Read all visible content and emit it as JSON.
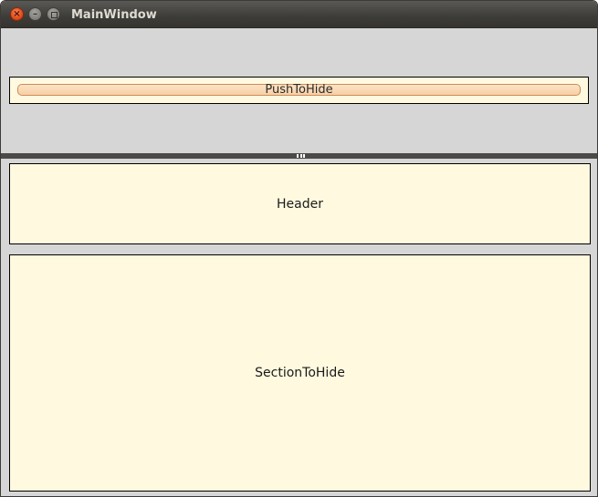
{
  "window": {
    "title": "MainWindow",
    "buttons": {
      "close_glyph": "×",
      "minimize_glyph": "–"
    }
  },
  "top_pane": {
    "push_button_label": "PushToHide"
  },
  "bottom_pane": {
    "header_label": "Header",
    "section_label": "SectionToHide"
  },
  "colors": {
    "frame_fill": "#fffadf",
    "window_bg": "#d6d6d6",
    "titlebar": "#3d3c38",
    "close_button": "#df4a16",
    "button_border": "#d08a5a"
  },
  "icons": [
    "close-icon",
    "minimize-icon",
    "maximize-icon",
    "splitter-grip-icon"
  ]
}
